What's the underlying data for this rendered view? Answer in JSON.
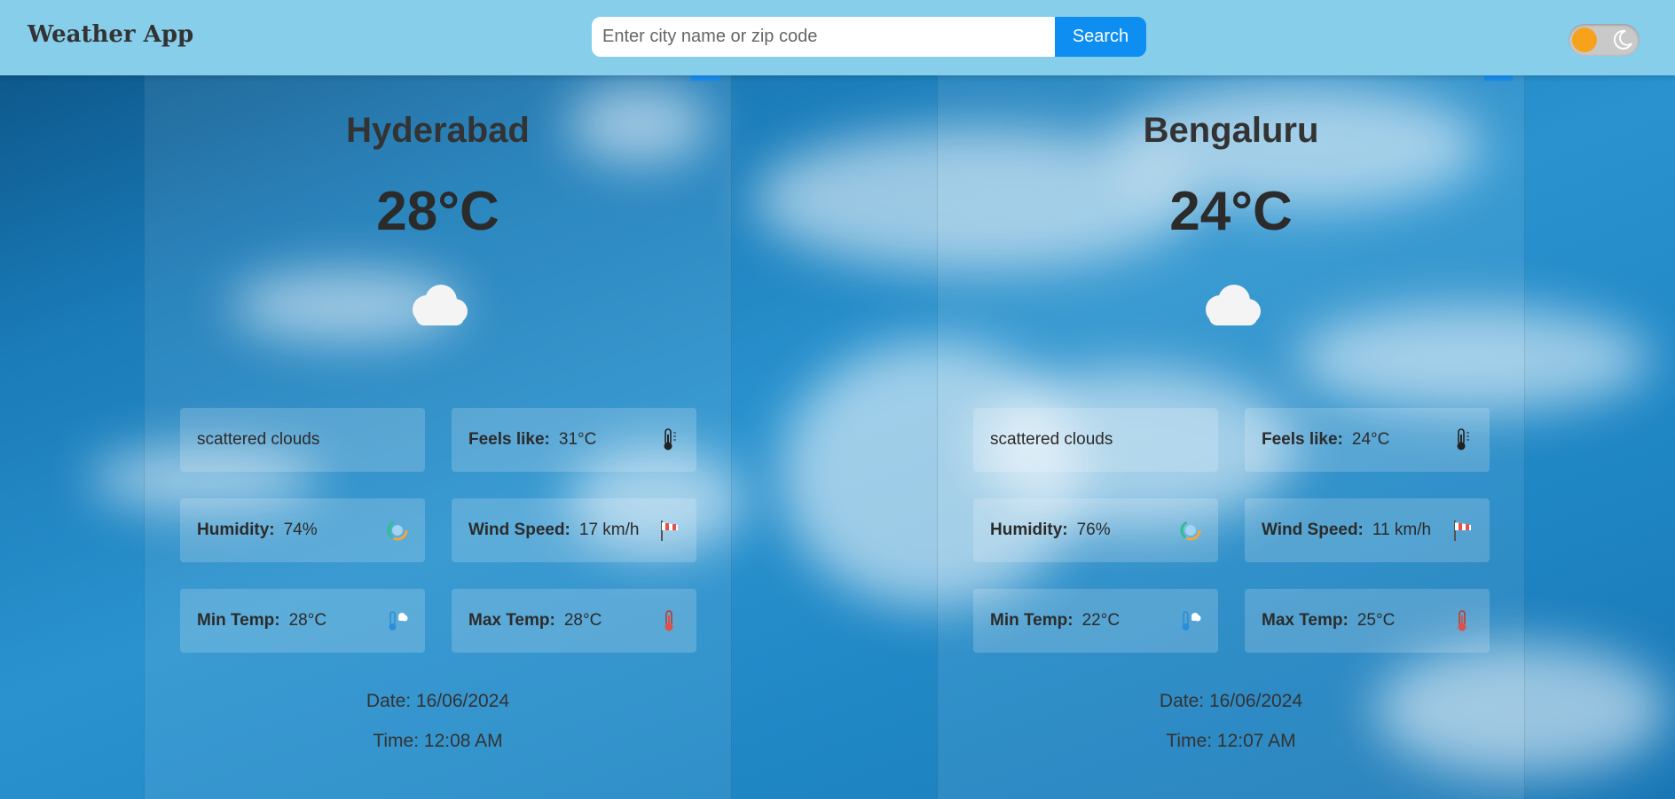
{
  "header": {
    "title": "Weather App",
    "search_placeholder": "Enter city name or zip code",
    "search_button": "Search"
  },
  "theme_toggle": {
    "state": "light",
    "knob_color": "#f7a21b"
  },
  "cards": [
    {
      "city": "Hyderabad",
      "temperature": "28°C",
      "condition_icon": "cloud-icon",
      "description": "scattered clouds",
      "feels_like": {
        "label": "Feels like:",
        "value": "31°C"
      },
      "humidity": {
        "label": "Humidity:",
        "value": "74%"
      },
      "wind_speed": {
        "label": "Wind Speed:",
        "value": "17 km/h"
      },
      "min_temp": {
        "label": "Min Temp:",
        "value": "28°C"
      },
      "max_temp": {
        "label": "Max Temp:",
        "value": "28°C"
      },
      "date": "Date: 16/06/2024",
      "time": "Time: 12:08 AM"
    },
    {
      "city": "Bengaluru",
      "temperature": "24°C",
      "condition_icon": "cloud-icon",
      "description": "scattered clouds",
      "feels_like": {
        "label": "Feels like:",
        "value": "24°C"
      },
      "humidity": {
        "label": "Humidity:",
        "value": "76%"
      },
      "wind_speed": {
        "label": "Wind Speed:",
        "value": "11 km/h"
      },
      "min_temp": {
        "label": "Min Temp:",
        "value": "22°C"
      },
      "max_temp": {
        "label": "Max Temp:",
        "value": "25°C"
      },
      "date": "Date: 16/06/2024",
      "time": "Time: 12:07 AM"
    }
  ],
  "colors": {
    "header_bg": "#87ceeb",
    "search_button_bg": "#0d8ef0",
    "accent": "#1a8cf0"
  }
}
